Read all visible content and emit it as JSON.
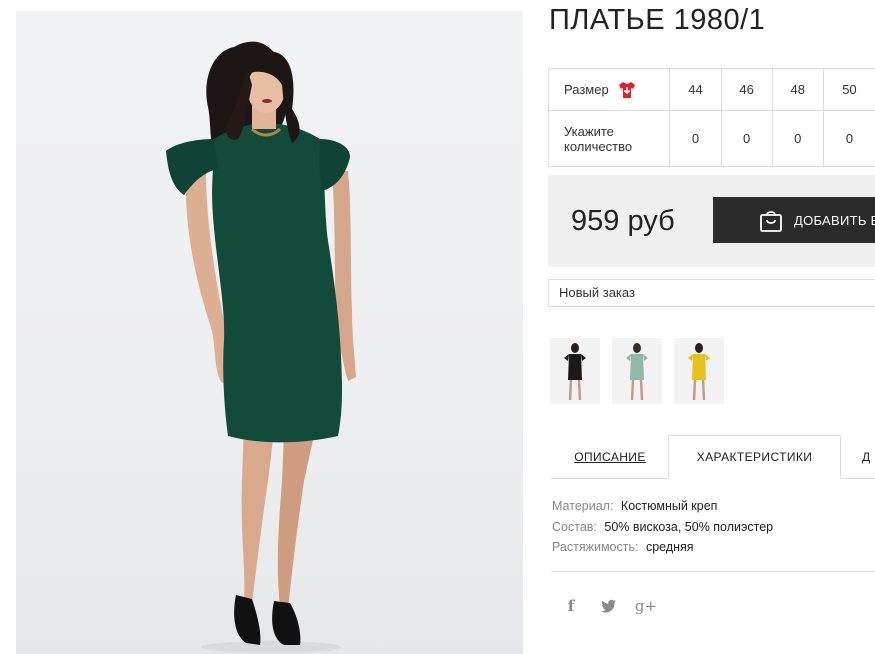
{
  "product": {
    "title": "ПЛАТЬЕ 1980/1",
    "price": "959 руб",
    "add_to_cart_label": "ДОБАВИТЬ В",
    "order_select_value": "Новый заказ"
  },
  "size_table": {
    "size_label": "Размер",
    "sizes": [
      "44",
      "46",
      "48",
      "50"
    ],
    "qty_label_line1": "Укажите",
    "qty_label_line2": "количество",
    "quantities": [
      "0",
      "0",
      "0",
      "0"
    ]
  },
  "thumbnails": [
    {
      "name": "black-dress",
      "color": "#1a1a1a"
    },
    {
      "name": "mint-dress",
      "color": "#8fb8a8"
    },
    {
      "name": "yellow-dress",
      "color": "#e6c21c"
    }
  ],
  "tabs": [
    {
      "label": "ОПИСАНИЕ"
    },
    {
      "label": "ХАРАКТЕРИСТИКИ"
    },
    {
      "label": "Д"
    }
  ],
  "specs": [
    {
      "key": "Материал:",
      "value": "Костюмный креп"
    },
    {
      "key": "Состав:",
      "value": "50% вискоза, 50% полиэстер"
    },
    {
      "key": "Растяжимость:",
      "value": "средняя"
    }
  ],
  "social": {
    "facebook": "f",
    "twitter": "twitter-icon",
    "google_plus": "g+"
  },
  "colors": {
    "dress_main": "#124b3a",
    "button_dark": "#2b2b2b",
    "price_bg": "#efefef",
    "size_icon_red": "#e0202a"
  }
}
